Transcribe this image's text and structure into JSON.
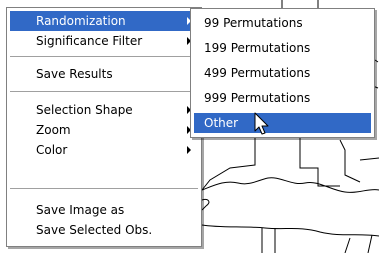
{
  "main_menu": {
    "items": [
      {
        "label": "Randomization",
        "has_submenu": true,
        "highlighted": true
      },
      {
        "label": "Significance Filter",
        "has_submenu": true
      },
      {
        "label": "Save Results",
        "has_submenu": false
      },
      {
        "label": "Selection Shape",
        "has_submenu": true
      },
      {
        "label": "Zoom",
        "has_submenu": true
      },
      {
        "label": "Color",
        "has_submenu": true
      },
      {
        "label": "Save Image as",
        "has_submenu": false
      },
      {
        "label": "Save Selected Obs.",
        "has_submenu": false
      }
    ]
  },
  "submenu": {
    "items": [
      {
        "label": "99 Permutations"
      },
      {
        "label": "199 Permutations"
      },
      {
        "label": "499 Permutations"
      },
      {
        "label": "999 Permutations"
      },
      {
        "label": "Other",
        "highlighted": true
      }
    ]
  },
  "colors": {
    "highlight": "#3169c6",
    "menu_bg": "#ffffff",
    "border": "#808080",
    "map_lines": "#000000"
  },
  "icons": [
    "submenu-arrow-icon",
    "mouse-pointer-icon"
  ]
}
